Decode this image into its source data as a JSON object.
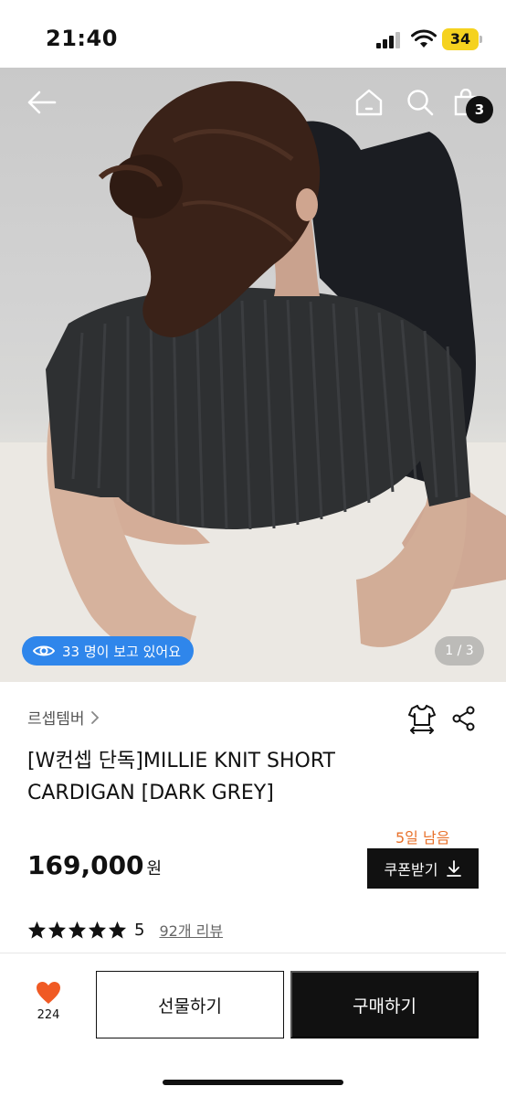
{
  "status_bar": {
    "time": "21:40",
    "battery": "34"
  },
  "hero": {
    "cart_count": "3",
    "viewers_text": "33 명이 보고 있어요",
    "page_indicator": "1 / 3"
  },
  "product": {
    "brand": "르셉템버",
    "title": "[W컨셉 단독]MILLIE KNIT SHORT CARDIGAN [DARK GREY]",
    "coupon_deadline": "5일 남음",
    "price": "169,000",
    "price_unit": "원",
    "coupon_button": "쿠폰받기",
    "rating": "5",
    "rating_stars": 5,
    "review_link": "92개 리뷰"
  },
  "bottom_bar": {
    "like_count": "224",
    "gift_button": "선물하기",
    "buy_button": "구매하기"
  },
  "colors": {
    "accent_blue": "#2f86eb",
    "heart": "#f05a24",
    "deadline_orange": "#e8712b",
    "battery_yellow": "#f5d21f"
  }
}
